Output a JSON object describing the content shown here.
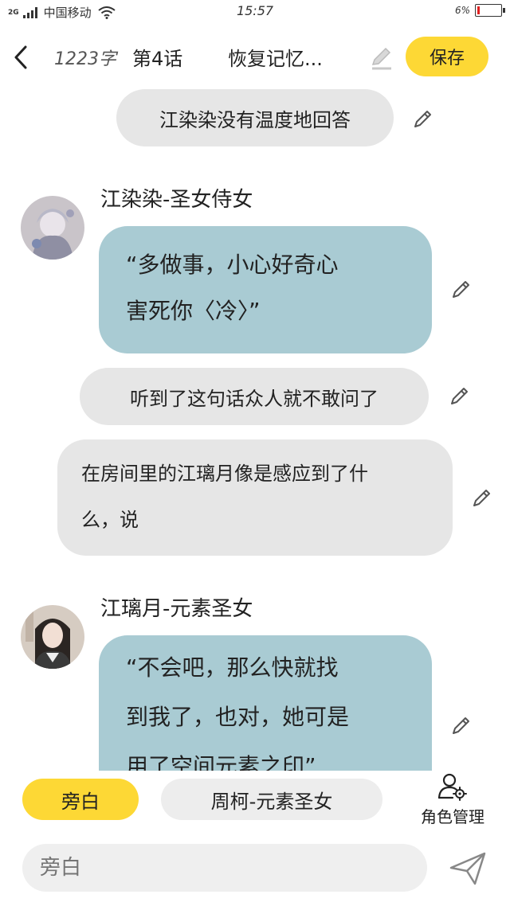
{
  "status_bar": {
    "network": "2G",
    "carrier": "中国移动",
    "time": "15:57",
    "battery": "6%",
    "battery_level": 0.06
  },
  "header": {
    "word_count": "1223字",
    "chapter": "第4话",
    "title": "恢复记忆...",
    "save_label": "保存"
  },
  "messages": [
    {
      "type": "narration",
      "text": "江染染没有温度地回答"
    },
    {
      "type": "dialogue",
      "speaker": "江染染-圣女侍女",
      "lines": [
        "“多做事，小心好奇心",
        "害死你〈冷〉”"
      ]
    },
    {
      "type": "narration",
      "text": "听到了这句话众人就不敢问了"
    },
    {
      "type": "narration",
      "lines": [
        "在房间里的江璃月像是感应到了什",
        "么，说"
      ]
    },
    {
      "type": "dialogue",
      "speaker": "江璃月-元素圣女",
      "lines": [
        "“不会吧，那么快就找",
        "到我了，也对，她可是",
        "用了空间元素之印”"
      ]
    }
  ],
  "bottom": {
    "roles": [
      "旁白",
      "周柯-元素圣女"
    ],
    "active_role": "旁白",
    "role_manage_label": "角色管理",
    "input_placeholder": "旁白"
  },
  "colors": {
    "accent": "#fdd835",
    "dialogue_bubble": "#a9cbd3",
    "narration_bubble": "#e6e6e6"
  }
}
